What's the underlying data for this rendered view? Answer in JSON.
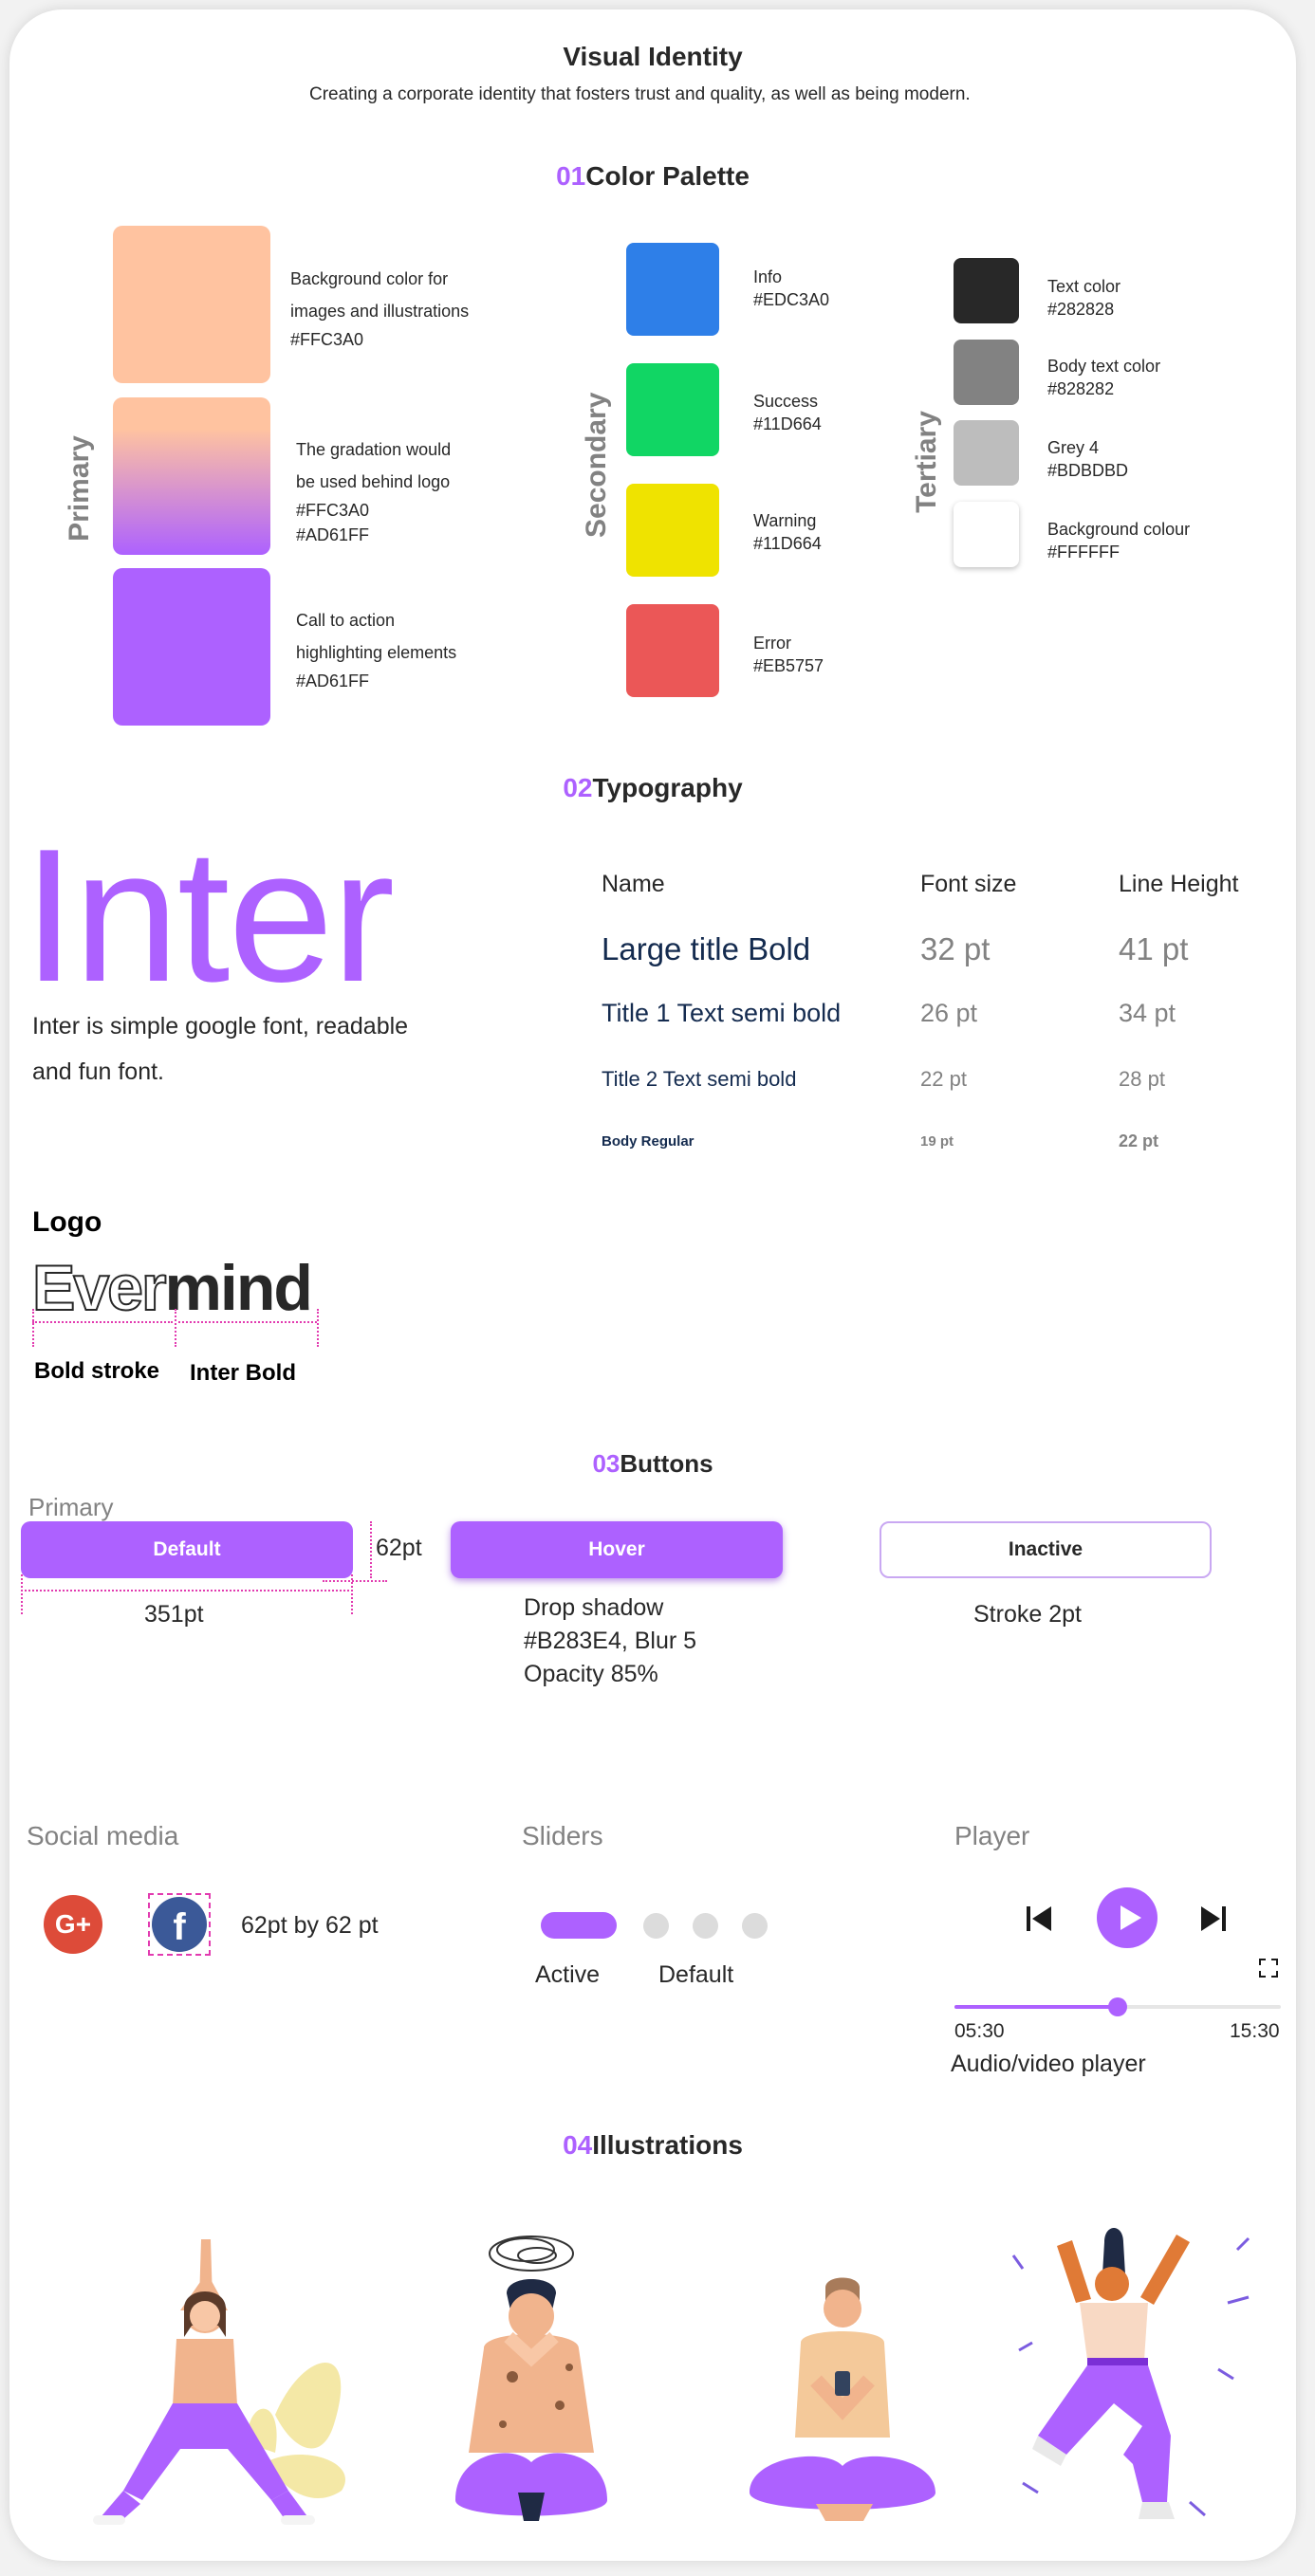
{
  "header": {
    "title": "Visual Identity",
    "subtitle": "Creating a corporate identity that fosters trust and quality, as well as being modern."
  },
  "sections": {
    "color": {
      "num": "01",
      "title": "Color Palette"
    },
    "typography": {
      "num": "02",
      "title": "Typography"
    },
    "buttons": {
      "num": "03",
      "title": "Buttons"
    },
    "illustrations": {
      "num": "04",
      "title": "Illustrations"
    }
  },
  "palette": {
    "primary_label": "Primary",
    "secondary_label": "Secondary",
    "tertiary_label": "Tertiary",
    "primary": [
      {
        "line1": "Background color for",
        "line2": "images and illustrations",
        "code": "#FFC3A0",
        "color": "#FFC3A0"
      },
      {
        "line1": "The gradation would",
        "line2": "be used behind logo",
        "code": "#FFC3A0",
        "code2": "#AD61FF",
        "color": "#FFC3A0",
        "color2": "#AD61FF"
      },
      {
        "line1": "Call to action",
        "line2": "highlighting elements",
        "code": "#AD61FF",
        "color": "#AD61FF"
      }
    ],
    "secondary": [
      {
        "name": "Info",
        "code": "#EDC3A0",
        "color": "#2E7FE8"
      },
      {
        "name": "Success",
        "code": "#11D664",
        "color": "#11D664"
      },
      {
        "name": "Warning",
        "code": "#11D664",
        "color": "#EFE300"
      },
      {
        "name": "Error",
        "code": "#EB5757",
        "color": "#EB5757"
      }
    ],
    "tertiary": [
      {
        "name": "Text color",
        "code": "#282828",
        "color": "#282828"
      },
      {
        "name": "Body text color",
        "code": "#828282",
        "color": "#828282"
      },
      {
        "name": "Grey 4",
        "code": "#BDBDBD",
        "color": "#BDBDBD"
      },
      {
        "name": "Background colour",
        "code": "#FFFFFF",
        "color": "#FFFFFF"
      }
    ]
  },
  "typography": {
    "font_name": "Inter",
    "desc_line1": "Inter is simple google font, readable",
    "desc_line2": "and fun font.",
    "columns": [
      "Name",
      "Font size",
      "Line Height"
    ],
    "rows": [
      {
        "name": "Large title Bold",
        "size": "32 pt",
        "line": "41 pt"
      },
      {
        "name": "Title 1 Text semi bold",
        "size": "26 pt",
        "line": "34 pt"
      },
      {
        "name": "Title 2 Text semi bold",
        "size": "22 pt",
        "line": "28 pt"
      },
      {
        "name": "Body Regular",
        "size": "19 pt",
        "line": "22 pt"
      }
    ]
  },
  "logo": {
    "heading": "Logo",
    "part1": "Ever",
    "part2": "mind",
    "label1": "Bold stroke",
    "label2": "Inter Bold"
  },
  "buttons": {
    "primary_label": "Primary",
    "default": "Default",
    "hover": "Hover",
    "inactive": "Inactive",
    "height_dim": "62pt",
    "width_dim": "351pt",
    "shadow_line1": "Drop shadow",
    "shadow_line2": "#B283E4, Blur 5",
    "shadow_line3": "Opacity 85%",
    "stroke": "Stroke 2pt"
  },
  "social": {
    "heading": "Social media",
    "google": "G+",
    "facebook": "f",
    "size": "62pt by 62 pt"
  },
  "sliders": {
    "heading": "Sliders",
    "active": "Active",
    "default": "Default"
  },
  "player": {
    "heading": "Player",
    "current": "05:30",
    "total": "15:30",
    "progress": 0.5,
    "caption": "Audio/video player"
  },
  "colors": {
    "accent": "#AD61FF",
    "text": "#282828",
    "body": "#828282",
    "navy": "#142B4F",
    "dim": "#E23BB0"
  }
}
